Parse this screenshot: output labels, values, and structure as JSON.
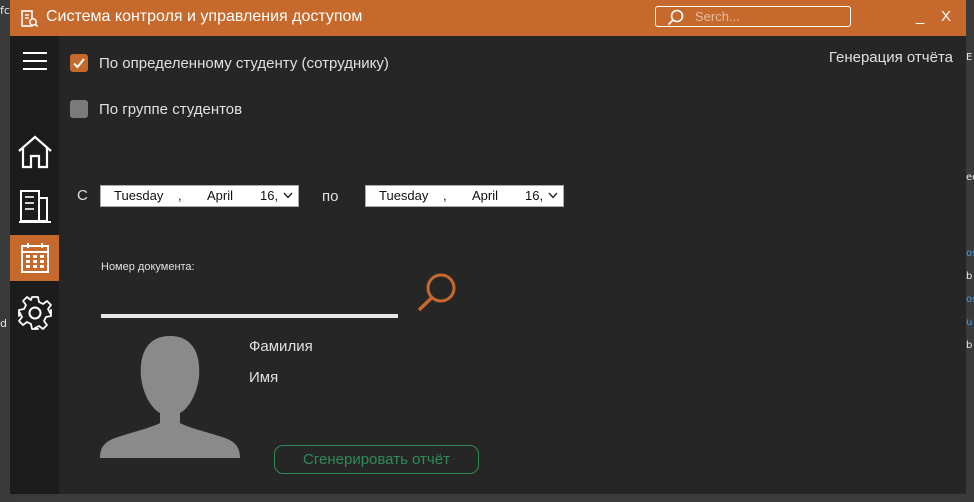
{
  "window": {
    "title": "Система контроля и управления доступом",
    "search_placeholder": "Serch...",
    "minimize_label": "_",
    "close_label": "X",
    "accent_color": "#c5692c"
  },
  "sidebar": {
    "items": [
      {
        "icon": "hamburger-menu-icon",
        "active": false
      },
      {
        "icon": "home-icon",
        "active": false
      },
      {
        "icon": "building-icon",
        "active": false
      },
      {
        "icon": "calendar-icon",
        "active": true
      },
      {
        "icon": "gear-icon",
        "active": false
      }
    ]
  },
  "report": {
    "title": "Генерация отчёта",
    "options": [
      {
        "label": "По определенному  студенту (сотруднику)",
        "checked": true
      },
      {
        "label": "По группе студентов",
        "checked": false
      }
    ],
    "from_label": "С",
    "to_label": "по",
    "date_from": {
      "weekday": "Tuesday",
      "sep": ",",
      "month": "April",
      "day": "16,"
    },
    "date_to": {
      "weekday": "Tuesday",
      "sep": ",",
      "month": "April",
      "day": "16,"
    },
    "document_label": "Номер документа:",
    "document_value": "",
    "surname_label": "Фамилия",
    "name_label": "Имя",
    "generate_button": "Сгенерировать отчёт",
    "generate_color": "#2e8b57"
  },
  "background": {
    "left_fragments": [
      "fc",
      "d"
    ],
    "right_fragments": [
      "E",
      "ec",
      "os",
      "b",
      "os",
      "u",
      "b"
    ]
  }
}
